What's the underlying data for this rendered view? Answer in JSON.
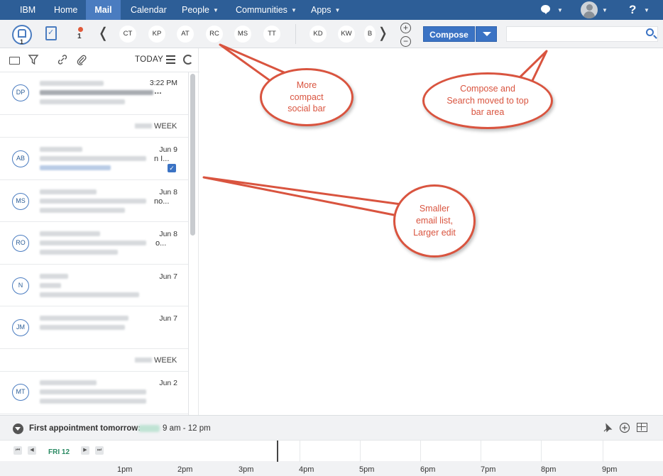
{
  "nav": {
    "items": [
      "IBM",
      "Home",
      "Mail",
      "Calendar",
      "People",
      "Communities",
      "Apps"
    ],
    "active": "Mail",
    "help": "?"
  },
  "social": {
    "me_count": "1",
    "alert_count": "1",
    "people_left": [
      "CT",
      "KP",
      "AT",
      "RC",
      "MS",
      "TT"
    ],
    "people_right": [
      "KD",
      "KW",
      "B"
    ],
    "prev": "❬",
    "next": "❭",
    "plus": "+",
    "minus": "−",
    "compose_label": "Compose",
    "search_value": ""
  },
  "toolbar": {
    "today": "TODAY"
  },
  "mail_rows": [
    {
      "initials": "DP",
      "date": "3:22 PM",
      "ellipsis": "…"
    },
    {
      "initials": "AB",
      "date": "Jun 9",
      "ellipsis": "n I..."
    },
    {
      "initials": "MS",
      "date": "Jun 8",
      "ellipsis": "no..."
    },
    {
      "initials": "RO",
      "date": "Jun 8",
      "ellipsis": "o..."
    },
    {
      "initials": "N",
      "date": "Jun 7",
      "ellipsis": ""
    },
    {
      "initials": "JM",
      "date": "Jun 7",
      "ellipsis": ""
    },
    {
      "initials": "MT",
      "date": "Jun 2",
      "ellipsis": ""
    }
  ],
  "week_label": "WEEK",
  "callouts": {
    "social": "More compact social bar",
    "compose": "Compose and Search moved to top bar area",
    "list": "Smaller email list, Larger edit"
  },
  "footer": {
    "first_appt": "First appointment tomorrow:",
    "appt_time": "9 am - 12 pm",
    "day": "FRI 12",
    "hours": [
      "1pm",
      "2pm",
      "3pm",
      "4pm",
      "5pm",
      "6pm",
      "7pm",
      "8pm",
      "9pm"
    ]
  },
  "colors": {
    "nav_bg": "#2d5e97",
    "nav_active": "#4a7cc0",
    "accent": "#3b73c4",
    "callout": "#d9543f",
    "day_green": "#2a8a63"
  }
}
